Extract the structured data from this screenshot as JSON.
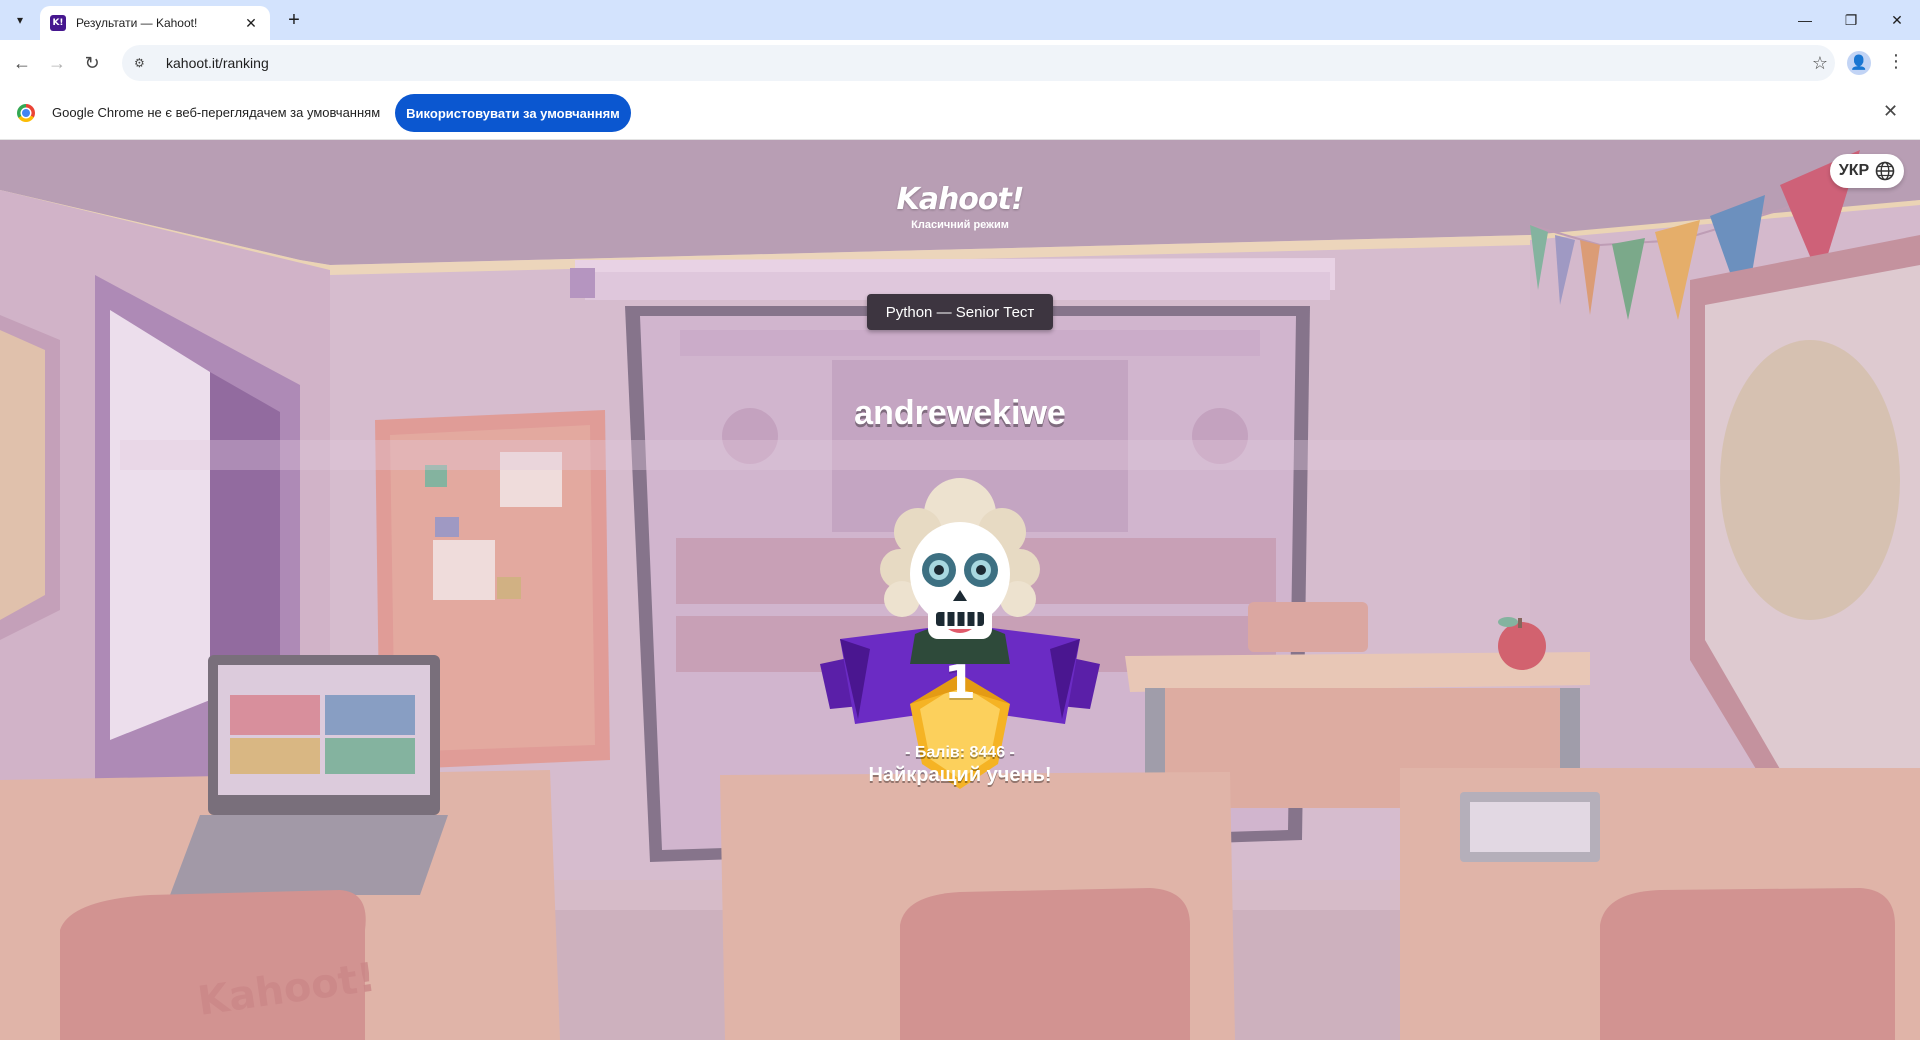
{
  "browser": {
    "tab_title": "Результати — Kahoot!",
    "tab_favicon": "K!",
    "url": "kahoot.it/ranking",
    "infobar": {
      "text": "Google Chrome не є веб-переглядачем за умовчанням",
      "button_label": "Використовувати за умовчанням"
    }
  },
  "page": {
    "language_label": "УКР",
    "logo": "Kahoot!",
    "mode": "Класичний режим",
    "quiz_title": "Python — Senior Тест",
    "player_name": "andrewekiwe",
    "rank": "1",
    "score_text": "- Балів: 8446 -",
    "achievement": "Найкращий учень!",
    "laptop_brand": "Kahoot!"
  },
  "colors": {
    "accent_blue": "#0b57d0",
    "kahoot_purple": "#46178f",
    "medal_gold": "#f5b324",
    "ribbon_purple": "#6b2bc4"
  }
}
